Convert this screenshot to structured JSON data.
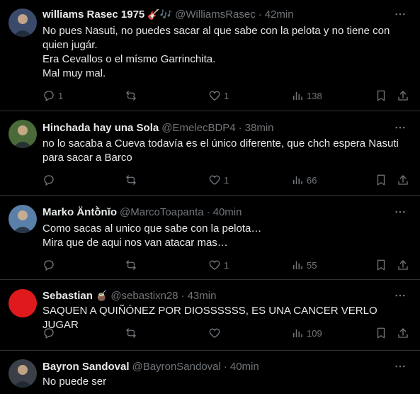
{
  "tweets": [
    {
      "name": "williams Rasec 1975",
      "emoji": "🎸🎶",
      "handle": "@WilliamsRasec",
      "sep": "·",
      "time": "42min",
      "lines": [
        "No pues Nasuti, no puedes sacar al que sabe con la pelota y no tiene con",
        "quien jugár.",
        "Era Cevallos o el mísmo Garrinchita.",
        "Mal muy mal."
      ],
      "replies": "1",
      "retweets": "",
      "likes": "1",
      "views": "138",
      "avatar_color": "#3a4a6b"
    },
    {
      "name": "Hinchada hay una Sola",
      "emoji": "",
      "handle": "@EmelecBDP4",
      "sep": "·",
      "time": "38min",
      "lines": [
        "no lo sacaba a Cueva todavía es el único diferente, que chch espera Nasuti",
        "para sacar a Barco"
      ],
      "replies": "",
      "retweets": "",
      "likes": "1",
      "views": "66",
      "avatar_color": "#4a6a3a"
    },
    {
      "name": "Marko Äntṑnĭo",
      "emoji": "",
      "handle": "@MarcoToapanta",
      "sep": "·",
      "time": "40min",
      "lines": [
        "Como sacas al unico que sabe con la pelota…",
        "Mira que de aqui nos van atacar mas…"
      ],
      "replies": "",
      "retweets": "",
      "likes": "1",
      "views": "55",
      "avatar_color": "#5a7fa8"
    },
    {
      "name": "Sebastian",
      "emoji": "🧉",
      "handle": "@sebastixn28",
      "sep": "·",
      "time": "43min",
      "lines": [
        "SAQUEN A QUIÑÓNEZ POR DIOSSSSSS, ES UNA CANCER VERLO JUGAR"
      ],
      "replies": "",
      "retweets": "",
      "likes": "",
      "views": "109",
      "avatar_color": "#e0191c"
    },
    {
      "name": "Bayron Sandoval",
      "emoji": "",
      "handle": "@BayronSandoval",
      "sep": "·",
      "time": "40min",
      "lines": [
        "No puede ser"
      ],
      "replies": "",
      "retweets": "",
      "likes": "",
      "views": "",
      "avatar_color": "#3b4048"
    }
  ],
  "icons": {
    "reply": "reply-icon",
    "retweet": "retweet-icon",
    "like": "like-icon",
    "views": "views-icon",
    "bookmark": "bookmark-icon",
    "share": "share-icon",
    "more": "more-icon"
  }
}
